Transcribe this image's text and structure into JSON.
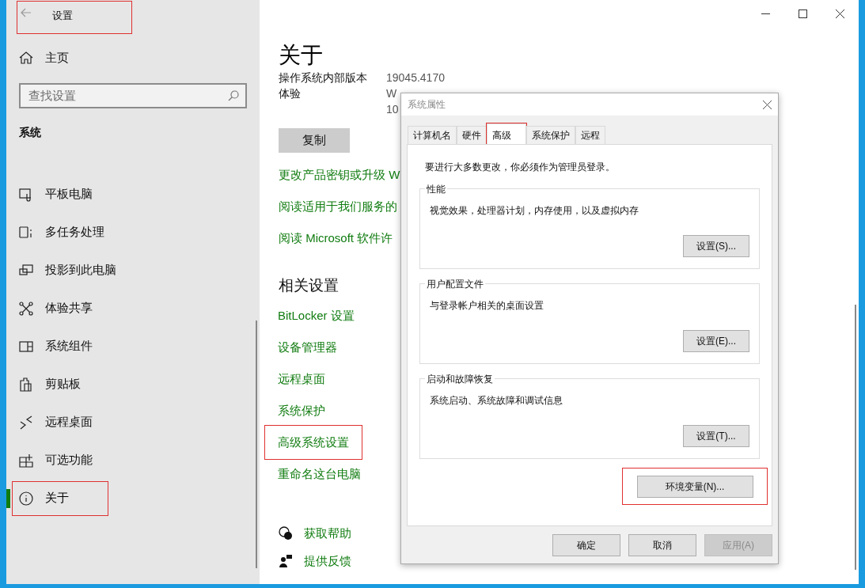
{
  "window": {
    "title": "设置",
    "highlighted": true
  },
  "sidebar": {
    "home": "主页",
    "search": {
      "placeholder": "查找设置"
    },
    "section": "系统",
    "items": [
      {
        "label": "平板电脑",
        "selected": false,
        "highlighted": false
      },
      {
        "label": "多任务处理",
        "selected": false,
        "highlighted": false
      },
      {
        "label": "投影到此电脑",
        "selected": false,
        "highlighted": false
      },
      {
        "label": "体验共享",
        "selected": false,
        "highlighted": false
      },
      {
        "label": "系统组件",
        "selected": false,
        "highlighted": false
      },
      {
        "label": "剪贴板",
        "selected": false,
        "highlighted": false
      },
      {
        "label": "远程桌面",
        "selected": false,
        "highlighted": false
      },
      {
        "label": "可选功能",
        "selected": false,
        "highlighted": false
      },
      {
        "label": "关于",
        "selected": true,
        "highlighted": true
      }
    ]
  },
  "content": {
    "title": "关于",
    "spec_rows": [
      {
        "label": "操作系统内部版本",
        "values": [
          "19045.4170"
        ]
      },
      {
        "label": "体验",
        "values": [
          "W",
          "10"
        ]
      }
    ],
    "copy_button": "复制",
    "links": [
      "更改产品密钥或升级 W",
      "阅读适用于我们服务的",
      "阅读 Microsoft 软件许"
    ],
    "related": {
      "heading": "相关设置",
      "links": [
        {
          "label": "BitLocker 设置",
          "highlighted": false
        },
        {
          "label": "设备管理器",
          "highlighted": false
        },
        {
          "label": "远程桌面",
          "highlighted": false
        },
        {
          "label": "系统保护",
          "highlighted": false
        },
        {
          "label": "高级系统设置",
          "highlighted": true
        },
        {
          "label": "重命名这台电脑",
          "highlighted": false
        }
      ]
    },
    "help": [
      "获取帮助",
      "提供反馈"
    ]
  },
  "dialog": {
    "title": "系统属性",
    "tabs": [
      {
        "label": "计算机名",
        "selected": false,
        "highlighted": false
      },
      {
        "label": "硬件",
        "selected": false,
        "highlighted": false
      },
      {
        "label": "高级",
        "selected": true,
        "highlighted": true
      },
      {
        "label": "系统保护",
        "selected": false,
        "highlighted": false
      },
      {
        "label": "远程",
        "selected": false,
        "highlighted": false
      }
    ],
    "notice": "要进行大多数更改，你必须作为管理员登录。",
    "groups": [
      {
        "title": "性能",
        "description": "视觉效果，处理器计划，内存使用，以及虚拟内存",
        "button": "设置(S)..."
      },
      {
        "title": "用户配置文件",
        "description": "与登录帐户相关的桌面设置",
        "button": "设置(E)..."
      },
      {
        "title": "启动和故障恢复",
        "description": "系统启动、系统故障和调试信息",
        "button": "设置(T)..."
      }
    ],
    "env_button": {
      "label": "环境变量(N)...",
      "highlighted": true
    },
    "buttons": [
      {
        "label": "确定",
        "disabled": false
      },
      {
        "label": "取消",
        "disabled": false
      },
      {
        "label": "应用(A)",
        "disabled": true
      }
    ]
  }
}
